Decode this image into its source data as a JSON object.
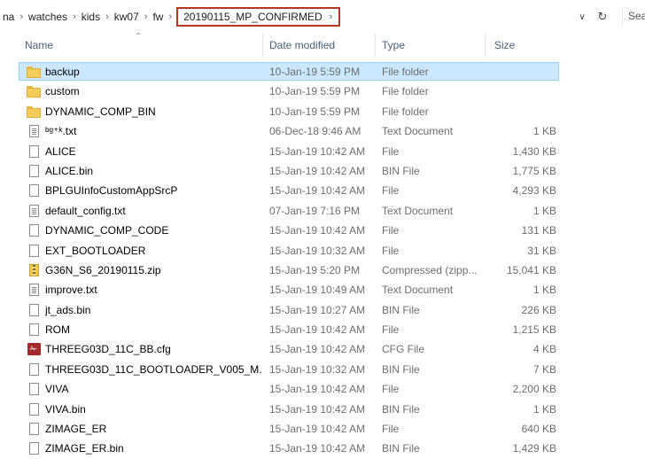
{
  "address": {
    "crumbs": [
      "na",
      "watches",
      "kids",
      "kw07",
      "fw"
    ],
    "current": "20190115_MP_CONFIRMED",
    "separator": "›",
    "dropdown_icon": "chevron-down-icon",
    "refresh_icon": "refresh-icon",
    "search_placeholder": "Sea"
  },
  "columns": {
    "name": "Name",
    "date": "Date modified",
    "type": "Type",
    "size": "Size"
  },
  "colors": {
    "selection": "#cce8ff",
    "highlight_border": "#b5371f",
    "header_text": "#4c607a"
  },
  "files": [
    {
      "icon": "folder-icon",
      "name": "backup",
      "date": "10-Jan-19 5:59 PM",
      "type": "File folder",
      "size": "",
      "selected": true
    },
    {
      "icon": "folder-icon",
      "name": "custom",
      "date": "10-Jan-19 5:59 PM",
      "type": "File folder",
      "size": ""
    },
    {
      "icon": "folder-icon",
      "name": "DYNAMIC_COMP_BIN",
      "date": "10-Jan-19 5:59 PM",
      "type": "File folder",
      "size": ""
    },
    {
      "icon": "text-document-icon",
      "name": "ᵇᵍ⁺ᵏ.txt",
      "date": "06-Dec-18 9:46 AM",
      "type": "Text Document",
      "size": "1 KB"
    },
    {
      "icon": "file-icon",
      "name": "ALICE",
      "date": "15-Jan-19 10:42 AM",
      "type": "File",
      "size": "1,430 KB"
    },
    {
      "icon": "file-icon",
      "name": "ALICE.bin",
      "date": "15-Jan-19 10:42 AM",
      "type": "BIN File",
      "size": "1,775 KB"
    },
    {
      "icon": "file-icon",
      "name": "BPLGUInfoCustomAppSrcP",
      "date": "15-Jan-19 10:42 AM",
      "type": "File",
      "size": "4,293 KB"
    },
    {
      "icon": "text-document-icon",
      "name": "default_config.txt",
      "date": "07-Jan-19 7:16 PM",
      "type": "Text Document",
      "size": "1 KB"
    },
    {
      "icon": "file-icon",
      "name": "DYNAMIC_COMP_CODE",
      "date": "15-Jan-19 10:42 AM",
      "type": "File",
      "size": "131 KB"
    },
    {
      "icon": "file-icon",
      "name": "EXT_BOOTLOADER",
      "date": "15-Jan-19 10:32 AM",
      "type": "File",
      "size": "31 KB"
    },
    {
      "icon": "zip-icon",
      "name": "G36N_S6_20190115.zip",
      "date": "15-Jan-19 5:20 PM",
      "type": "Compressed (zipp...",
      "size": "15,041 KB"
    },
    {
      "icon": "text-document-icon",
      "name": "improve.txt",
      "date": "15-Jan-19 10:49 AM",
      "type": "Text Document",
      "size": "1 KB"
    },
    {
      "icon": "file-icon",
      "name": "jt_ads.bin",
      "date": "15-Jan-19 10:27 AM",
      "type": "BIN File",
      "size": "226 KB"
    },
    {
      "icon": "file-icon",
      "name": "ROM",
      "date": "15-Jan-19 10:42 AM",
      "type": "File",
      "size": "1,215 KB"
    },
    {
      "icon": "cfg-icon",
      "name": "THREEG03D_11C_BB.cfg",
      "date": "15-Jan-19 10:42 AM",
      "type": "CFG File",
      "size": "4 KB"
    },
    {
      "icon": "file-icon",
      "name": "THREEG03D_11C_BOOTLOADER_V005_M...",
      "date": "15-Jan-19 10:32 AM",
      "type": "BIN File",
      "size": "7 KB"
    },
    {
      "icon": "file-icon",
      "name": "VIVA",
      "date": "15-Jan-19 10:42 AM",
      "type": "File",
      "size": "2,200 KB"
    },
    {
      "icon": "file-icon",
      "name": "VIVA.bin",
      "date": "15-Jan-19 10:42 AM",
      "type": "BIN File",
      "size": "1 KB"
    },
    {
      "icon": "file-icon",
      "name": "ZIMAGE_ER",
      "date": "15-Jan-19 10:42 AM",
      "type": "File",
      "size": "640 KB"
    },
    {
      "icon": "file-icon",
      "name": "ZIMAGE_ER.bin",
      "date": "15-Jan-19 10:42 AM",
      "type": "BIN File",
      "size": "1,429 KB"
    }
  ]
}
